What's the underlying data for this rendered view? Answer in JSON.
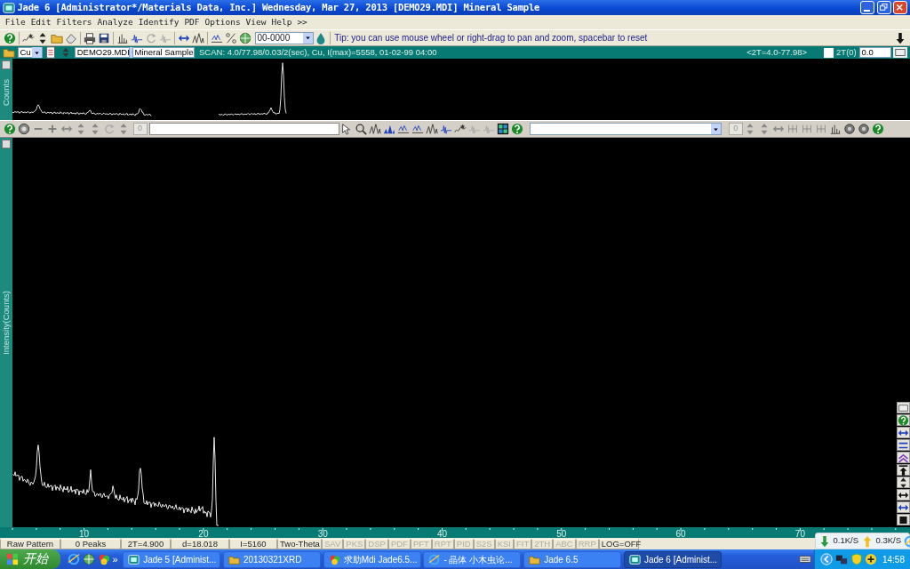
{
  "window": {
    "title": "Jade 6 [Administrator*/Materials Data, Inc.] Wednesday, Mar 27, 2013 [DEMO29.MDI] Mineral Sample"
  },
  "menu": [
    {
      "label": "File"
    },
    {
      "label": "Edit"
    },
    {
      "label": "Filters"
    },
    {
      "label": "Analyze"
    },
    {
      "label": "Identify"
    },
    {
      "label": "PDF"
    },
    {
      "label": "Options"
    },
    {
      "label": "View"
    },
    {
      "label": "Help"
    },
    {
      "label": ">>"
    }
  ],
  "toolbar": {
    "pdf_number": "00-0000",
    "tip": "Tip: you can use mouse wheel or right-drag to pan and zoom, spacebar to reset"
  },
  "file_bar": {
    "radiation": "Cu",
    "file": "DEMO29.MDI",
    "sample": "Mineral Sample",
    "scan": "SCAN: 4.0/77.98/0.03/2(sec), Cu, I(max)=5558, 01-02-99 04:00",
    "range": "<2T=4.0-77.98>",
    "zero_checked": false,
    "zero_label": "2T(0)",
    "zero_value": "0.0"
  },
  "overview": {
    "ylabel": "Counts"
  },
  "plot_toolbar": {
    "left_count": "0",
    "right_count": "0"
  },
  "main_plot": {
    "ylabel": "Intensity(Counts)",
    "x_ticks": [
      "10",
      "20",
      "30",
      "40",
      "50",
      "60",
      "70"
    ]
  },
  "status_bar": [
    {
      "text": "Raw Pattern",
      "disabled": false
    },
    {
      "text": "0 Peaks",
      "disabled": false
    },
    {
      "text": "2T=4.900",
      "disabled": false
    },
    {
      "text": "d=18.018",
      "disabled": false
    },
    {
      "text": "I=5160",
      "disabled": false
    },
    {
      "text": "Two-Theta",
      "disabled": false
    },
    {
      "text": "SAV",
      "disabled": true
    },
    {
      "text": "PKS",
      "disabled": true
    },
    {
      "text": "DSP",
      "disabled": true
    },
    {
      "text": "PDF",
      "disabled": true
    },
    {
      "text": "PFT",
      "disabled": true
    },
    {
      "text": "RPT",
      "disabled": true
    },
    {
      "text": "PID",
      "disabled": true
    },
    {
      "text": "S2S",
      "disabled": true
    },
    {
      "text": "KSI",
      "disabled": true
    },
    {
      "text": "FIT",
      "disabled": true
    },
    {
      "text": "2TH",
      "disabled": true
    },
    {
      "text": "ABC",
      "disabled": true
    },
    {
      "text": "RRP",
      "disabled": true
    },
    {
      "text": "LOG=OFF",
      "disabled": false
    }
  ],
  "net_speed": {
    "down": "0.1K/S",
    "up": "0.3K/S"
  },
  "taskbar": {
    "start": "开始",
    "quick_more": "»",
    "tasks": [
      {
        "label": "Jade 5 [Administ...",
        "kind": "app",
        "selected": false
      },
      {
        "label": "20130321XRD",
        "kind": "folder",
        "selected": false
      },
      {
        "label": "求助Mdi Jade6.5...",
        "kind": "web",
        "selected": false
      },
      {
        "label": "- 晶体 小木虫论...",
        "kind": "browser",
        "selected": false
      },
      {
        "label": "Jade 6.5",
        "kind": "folder",
        "selected": false
      },
      {
        "label": "Jade 6 [Administ...",
        "kind": "app",
        "selected": true
      }
    ],
    "clock": "14:58"
  }
}
